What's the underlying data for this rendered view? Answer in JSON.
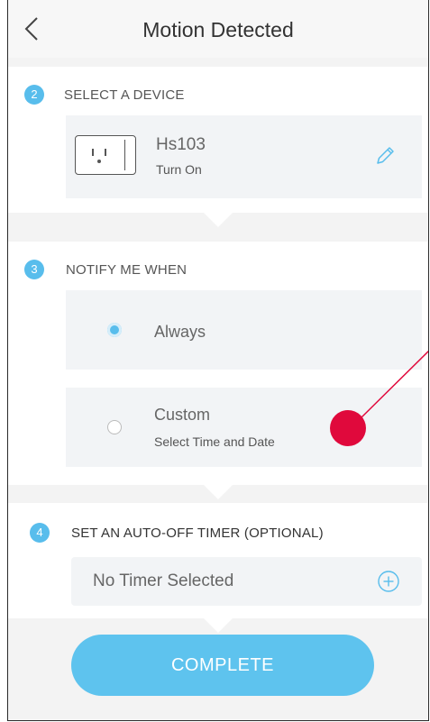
{
  "header": {
    "title": "Motion Detected",
    "back_icon": "chevron-left-icon"
  },
  "steps": [
    {
      "number": "2",
      "title": "SELECT A DEVICE"
    },
    {
      "number": "3",
      "title": "NOTIFY ME WHEN"
    },
    {
      "number": "4",
      "title": "SET AN AUTO-OFF TIMER (OPTIONAL)"
    }
  ],
  "device": {
    "name": "Hs103",
    "action": "Turn On",
    "icon": "smart-plug-icon",
    "edit_icon": "pencil-icon"
  },
  "notify": {
    "options": [
      {
        "label": "Always",
        "selected": true
      },
      {
        "label": "Custom",
        "sublabel": "Select Time and Date",
        "selected": false
      }
    ]
  },
  "timer": {
    "value": "No Timer Selected",
    "add_icon": "plus-circle-icon"
  },
  "complete_label": "COMPLETE",
  "colors": {
    "accent": "#58bdec",
    "button": "#5ec3ee",
    "tap_indicator": "#e0093c",
    "card_bg": "#f2f4f6"
  }
}
